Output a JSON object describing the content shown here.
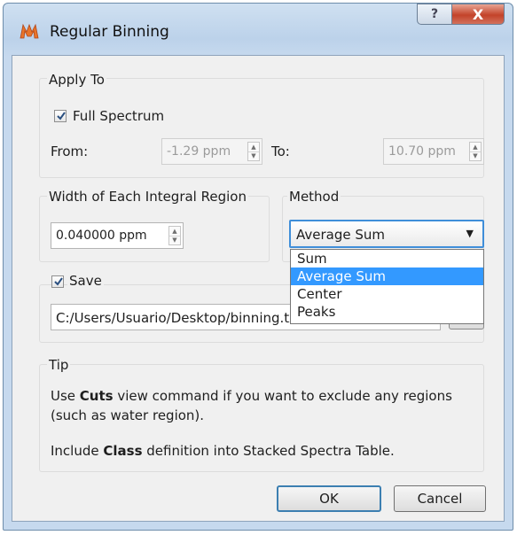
{
  "window": {
    "title": "Regular Binning",
    "help_button": "?",
    "close_button": "X"
  },
  "apply_to": {
    "group_title": "Apply To",
    "full_spectrum_label": "Full Spectrum",
    "full_spectrum_checked": true,
    "from_label": "From:",
    "from_value": "-1.29 ppm",
    "to_label": "To:",
    "to_value": "10.70 ppm"
  },
  "width_region": {
    "group_title": "Width of Each Integral Region",
    "value": "0.040000 ppm"
  },
  "method": {
    "group_title": "Method",
    "selected": "Average Sum",
    "options": [
      "Sum",
      "Average Sum",
      "Center",
      "Peaks"
    ],
    "highlighted_index": 1
  },
  "save": {
    "group_title": "Save",
    "checked": true,
    "path_value": "C:/Users/Usuario/Desktop/binning.txt"
  },
  "tip": {
    "group_title": "Tip",
    "line1_prefix": "Use ",
    "line1_bold": "Cuts",
    "line1_suffix": " view command if you want to exclude any regions",
    "line2": "(such as water region).",
    "line3_prefix": "Include ",
    "line3_bold": "Class",
    "line3_suffix": " definition into Stacked Spectra Table."
  },
  "buttons": {
    "ok": "OK",
    "cancel": "Cancel"
  },
  "colors": {
    "accent": "#3399ff",
    "focus_border": "#3f8ed9",
    "close_red": "#c3432a",
    "title_blue": "#bcd2ea"
  },
  "icons": [
    "app-logo-icon",
    "help-icon",
    "close-icon",
    "checkmark-icon",
    "spin-up-icon",
    "spin-down-icon",
    "dropdown-arrow-icon"
  ]
}
